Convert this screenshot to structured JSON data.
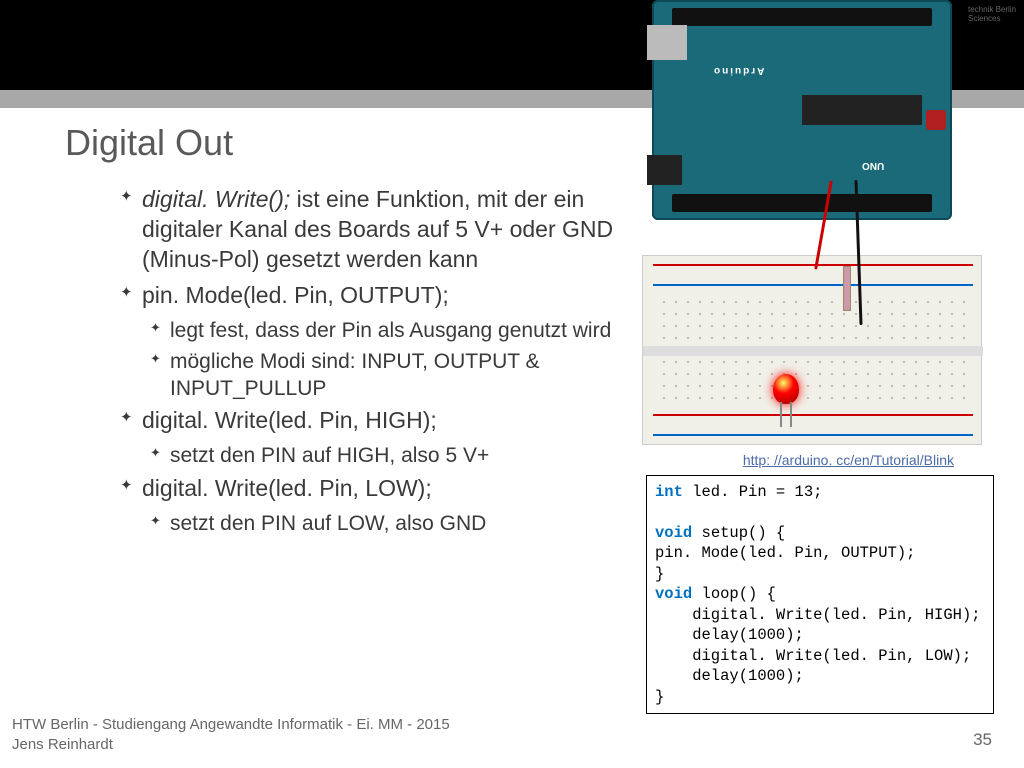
{
  "header": {
    "title": "Digital Out",
    "logo_hint": "technik Berlin Sciences"
  },
  "bullets": {
    "b1_fn": "digital. Write();",
    "b1_rest": " ist eine Funktion, mit der ein digitaler Kanal des Boards auf 5 V+ oder GND (Minus-Pol) gesetzt werden kann",
    "b2": "pin. Mode(led. Pin, OUTPUT);",
    "b2_s1": "legt fest, dass der Pin als Ausgang genutzt wird",
    "b2_s2": "mögliche Modi sind: INPUT, OUTPUT & INPUT_PULLUP",
    "b3": "digital. Write(led. Pin, HIGH);",
    "b3_s1": "setzt den PIN auf HIGH, also 5 V+",
    "b4": "digital. Write(led. Pin, LOW);",
    "b4_s1": "setzt den PIN auf LOW, also GND"
  },
  "link": {
    "text": "http: //arduino. cc/en/Tutorial/Blink"
  },
  "board_labels": {
    "uno": "UNO",
    "arduino": "Arduino"
  },
  "code": {
    "l1a": "int",
    "l1b": " led. Pin = 13;",
    "blank": "",
    "l2a": "void",
    "l2b": " setup() {",
    "l3": "pin. Mode(led. Pin, OUTPUT);",
    "l4": "}",
    "l5a": "void",
    "l5b": " loop() {",
    "l6": "    digital. Write(led. Pin, HIGH);",
    "l7": "    delay(1000);",
    "l8": "    digital. Write(led. Pin, LOW);",
    "l9": "    delay(1000);",
    "l10": "}"
  },
  "footer": {
    "line1": "HTW Berlin - Studiengang Angewandte Informatik - Ei. MM - 2015",
    "line2": "Jens Reinhardt",
    "page": "35"
  }
}
